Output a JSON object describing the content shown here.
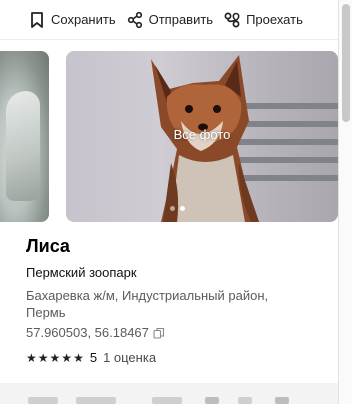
{
  "actions": {
    "save_label": "Сохранить",
    "share_label": "Отправить",
    "route_label": "Проехать"
  },
  "gallery": {
    "overlay_label": "Все фото",
    "total_dots": 2,
    "active_dot": 1
  },
  "place": {
    "name": "Лиса",
    "category": "Пермский зоопарк",
    "address": "Бахаревка ж/м, Индустриальный район, Пермь",
    "coordinates": "57.960503, 56.18467",
    "rating_stars": 5,
    "rating_value": "5",
    "ratings_count": "1 оценка"
  },
  "icons": {
    "save": "bookmark-icon",
    "share": "share-icon",
    "route": "route-icon",
    "copy": "copy-icon",
    "star": "star-icon"
  }
}
